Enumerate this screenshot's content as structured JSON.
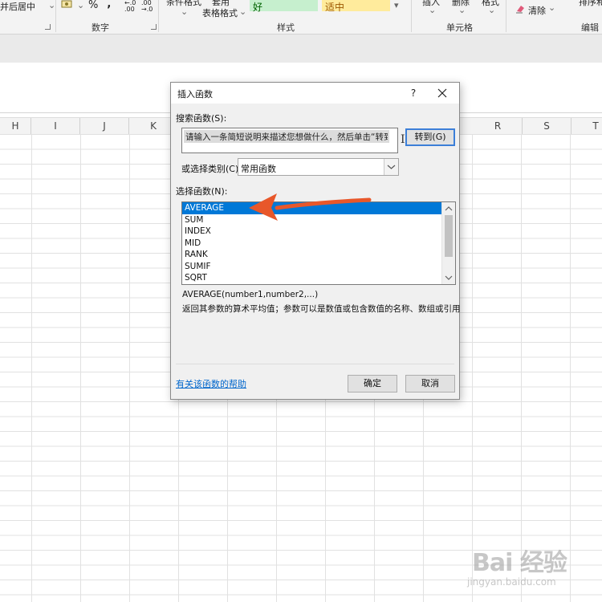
{
  "ribbon": {
    "merge_center": "并后居中",
    "merge_arrow": "⌄",
    "currency_icon": "currency-icon",
    "percent": "%",
    "comma": "‚",
    "inc_decimal": "←.0\n.00",
    "dec_decimal": ".00\n→.0",
    "number_group": "数字",
    "table_format_top": "套用",
    "table_format": "表格格式",
    "cond_format": "条件格式",
    "style_good": "好",
    "style_neutral": "适中",
    "styles_group": "样式",
    "insert": "插入",
    "delete": "删除",
    "format": "格式",
    "cells_group": "单元格",
    "clear": "清除",
    "clear_arrow": "⌄",
    "editing_group": "编辑",
    "sort_filter": "排序和"
  },
  "columns": [
    "H",
    "I",
    "J",
    "K",
    "R",
    "S",
    "T"
  ],
  "dialog": {
    "title": "插入函数",
    "help_glyph": "?",
    "search_label": "搜索函数(S):",
    "search_value": "请输入一条简短说明来描述您想做什么，然后单击“转到”",
    "goto_button": "转到(G)",
    "category_label": "或选择类别(C):",
    "category_value": "常用函数",
    "function_label": "选择函数(N):",
    "functions": [
      "AVERAGE",
      "SUM",
      "INDEX",
      "MID",
      "RANK",
      "SUMIF",
      "SQRT"
    ],
    "syntax": "AVERAGE(number1,number2,...)",
    "description": "返回其参数的算术平均值；参数可以是数值或包含数值的名称、数组或引用",
    "help_link": "有关该函数的帮助",
    "ok_button": "确定",
    "cancel_button": "取消"
  },
  "watermark": {
    "logo_text": "Bai 经验",
    "url": "jingyan.baidu.com"
  },
  "colors": {
    "accent": "#0078d7",
    "arrow": "#e8572a",
    "link": "#0066cc"
  }
}
